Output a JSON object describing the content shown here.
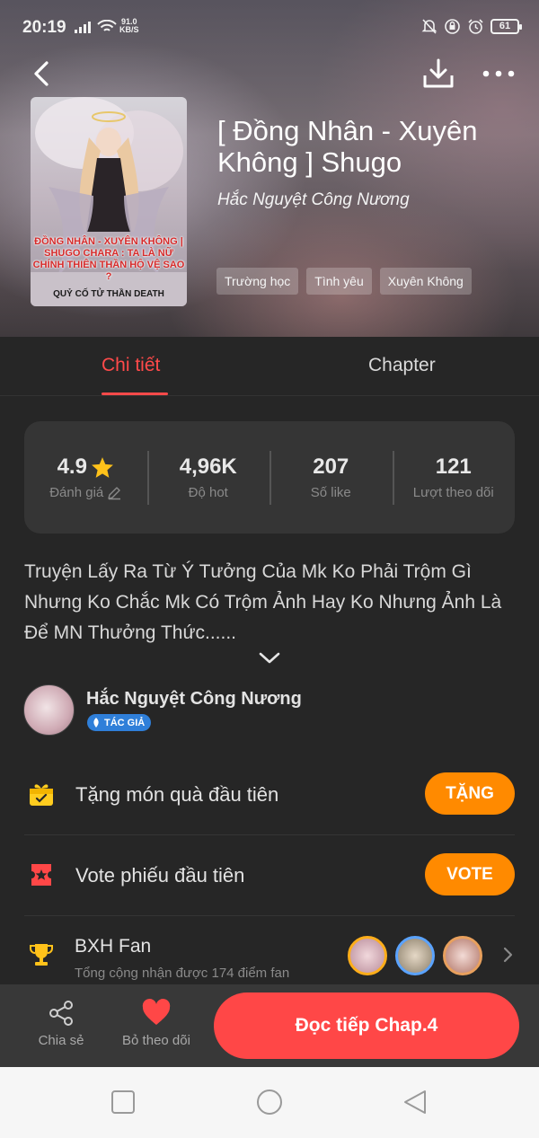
{
  "status_bar": {
    "time": "20:19",
    "net_speed_value": "91.0",
    "net_speed_unit": "KB/S",
    "battery": "61"
  },
  "book": {
    "title": "[ Đồng Nhân - Xuyên Không ] Shugo",
    "author": "Hắc Nguyệt Công Nương",
    "tags": [
      "Trường học",
      "Tình yêu",
      "Xuyên Không"
    ],
    "cover_title": "ĐỒNG NHÂN - XUYÊN KHÔNG | SHUGO CHARA : TA LÀ NỮ CHÍNH THIÊN THẦN HỘ VỆ SAO ?",
    "cover_author": "QUỶ CỐ TỬ THẦN DEATH"
  },
  "tabs": [
    {
      "label": "Chi tiết",
      "active": true
    },
    {
      "label": "Chapter",
      "active": false
    }
  ],
  "stats": [
    {
      "value": "4.9",
      "label": "Đánh giá"
    },
    {
      "value": "4,96K",
      "label": "Độ hot"
    },
    {
      "value": "207",
      "label": "Số like"
    },
    {
      "value": "121",
      "label": "Lượt theo dõi"
    }
  ],
  "description": "Truyện Lấy Ra Từ Ý Tưởng Của Mk Ko Phải Trộm Gì Nhưng Ko Chắc Mk Có Trộm Ảnh Hay Ko Nhưng Ảnh Là Để MN Thưởng Thức......",
  "author_section": {
    "name": "Hắc Nguyệt Công Nương",
    "badge": "TÁC GIẢ"
  },
  "actions": {
    "gift_label": "Tặng món quà đầu tiên",
    "gift_button": "TẶNG",
    "vote_label": "Vote phiếu đầu tiên",
    "vote_button": "VOTE",
    "fan_title": "BXH Fan",
    "fan_subtitle": "Tổng cộng nhận được 174 điểm fan"
  },
  "bottom_bar": {
    "share": "Chia sẻ",
    "unfollow": "Bỏ theo dõi",
    "read": "Đọc tiếp Chap.4"
  },
  "colors": {
    "accent_red": "#ff4a4a",
    "accent_orange": "#ff8a00",
    "background": "#262626",
    "badge_blue": "#2f7fd9"
  },
  "icons": [
    "back-icon",
    "download-icon",
    "more-icon",
    "star-icon",
    "pencil-icon",
    "chevron-down-icon",
    "gift-icon",
    "ticket-icon",
    "trophy-icon",
    "chevron-right-icon",
    "share-icon",
    "heart-icon"
  ]
}
